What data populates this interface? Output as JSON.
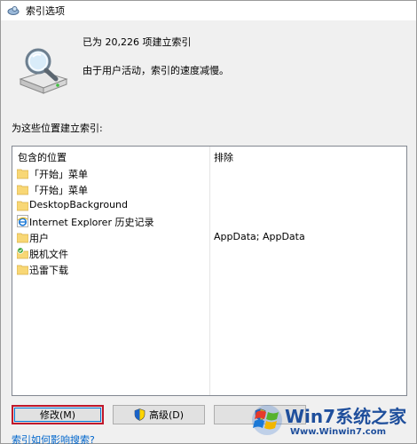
{
  "window": {
    "title": "索引选项",
    "title_icon": "indexing-options-icon"
  },
  "status": {
    "count_text": "已为 20,226 项建立索引",
    "message": "由于用户活动，索引的速度减慢。"
  },
  "section_label": "为这些位置建立索引:",
  "list": {
    "headers": {
      "included": "包含的位置",
      "excluded": "排除"
    },
    "rows": [
      {
        "location": "「开始」菜单",
        "exclude": "",
        "icon": "folder-icon"
      },
      {
        "location": "「开始」菜单",
        "exclude": "",
        "icon": "folder-icon"
      },
      {
        "location": "DesktopBackground",
        "exclude": "",
        "icon": "folder-icon"
      },
      {
        "location": "Internet Explorer 历史记录",
        "exclude": "",
        "icon": "internet-explorer-icon"
      },
      {
        "location": "用户",
        "exclude": "AppData; AppData",
        "icon": "folder-icon"
      },
      {
        "location": "脱机文件",
        "exclude": "",
        "icon": "offline-files-icon"
      },
      {
        "location": "迅雷下载",
        "exclude": "",
        "icon": "folder-icon"
      }
    ]
  },
  "buttons": {
    "modify": "修改(M)",
    "advanced": "高级(D)"
  },
  "help_link": "索引如何影响搜索?",
  "watermark": {
    "line1": "Win7系统之家",
    "line2": "Www.Winwin7.com"
  },
  "colors": {
    "highlight_border": "#c0182c",
    "link": "#0066cc"
  }
}
